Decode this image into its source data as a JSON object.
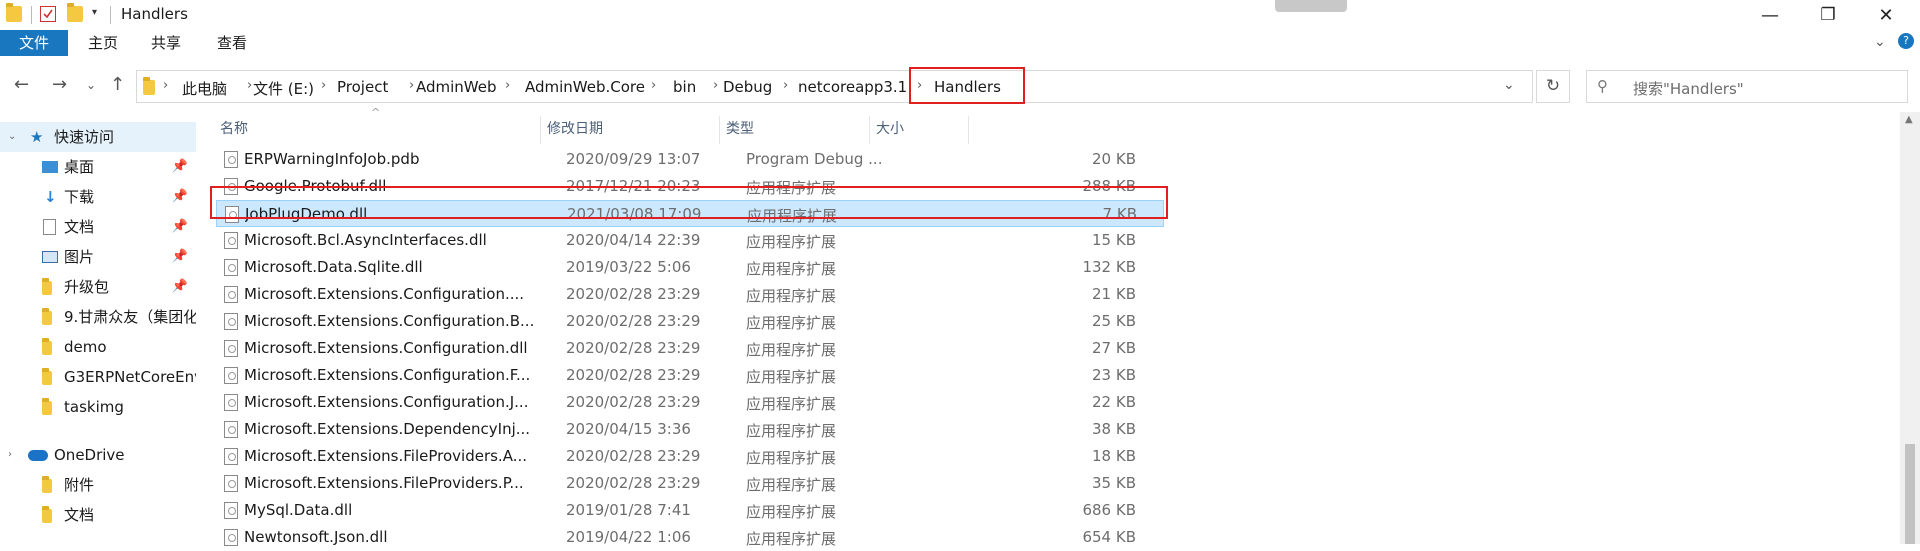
{
  "window": {
    "title": "Handlers",
    "minimize_glyph": "—",
    "restore_glyph": "❐",
    "close_glyph": "✕"
  },
  "ribbon": {
    "tabs": [
      "文件",
      "主页",
      "共享",
      "查看"
    ]
  },
  "address": {
    "crumbs": [
      "此电脑",
      "文件 (E:)",
      "Project",
      "AdminWeb",
      "AdminWeb.Core",
      "bin",
      "Debug",
      "netcoreapp3.1",
      "Handlers"
    ],
    "search_placeholder": "搜索\"Handlers\""
  },
  "columns": {
    "name": "名称",
    "date": "修改日期",
    "type": "类型",
    "size": "大小"
  },
  "nav": {
    "quick_access": "快速访问",
    "items": [
      {
        "label": "桌面",
        "pinned": true,
        "icon": "desktop-icon"
      },
      {
        "label": "下载",
        "pinned": true,
        "icon": "download-icon"
      },
      {
        "label": "文档",
        "pinned": true,
        "icon": "document-icon"
      },
      {
        "label": "图片",
        "pinned": true,
        "icon": "picture-icon"
      },
      {
        "label": "升级包",
        "pinned": true,
        "icon": "folder-icon"
      },
      {
        "label": "9.甘肃众友（集团化",
        "pinned": false,
        "icon": "folder-icon"
      },
      {
        "label": "demo",
        "pinned": false,
        "icon": "folder-icon"
      },
      {
        "label": "G3ERPNetCoreEnv",
        "pinned": false,
        "icon": "folder-icon"
      },
      {
        "label": "taskimg",
        "pinned": false,
        "icon": "folder-icon"
      }
    ],
    "onedrive": "OneDrive",
    "onedrive_items": [
      {
        "label": "附件",
        "icon": "folder-icon"
      },
      {
        "label": "文档",
        "icon": "folder-icon"
      }
    ]
  },
  "files": [
    {
      "name": "ERPWarningInfoJob.pdb",
      "date": "2020/09/29 13:07",
      "type": "Program Debug ...",
      "size": "20 KB",
      "selected": false
    },
    {
      "name": "Google.Protobuf.dll",
      "date": "2017/12/21 20:23",
      "type": "应用程序扩展",
      "size": "288 KB",
      "selected": false
    },
    {
      "name": "JobPlugDemo.dll",
      "date": "2021/03/08 17:09",
      "type": "应用程序扩展",
      "size": "7 KB",
      "selected": true
    },
    {
      "name": "Microsoft.Bcl.AsyncInterfaces.dll",
      "date": "2020/04/14 22:39",
      "type": "应用程序扩展",
      "size": "15 KB",
      "selected": false
    },
    {
      "name": "Microsoft.Data.Sqlite.dll",
      "date": "2019/03/22 5:06",
      "type": "应用程序扩展",
      "size": "132 KB",
      "selected": false
    },
    {
      "name": "Microsoft.Extensions.Configuration....",
      "date": "2020/02/28 23:29",
      "type": "应用程序扩展",
      "size": "21 KB",
      "selected": false
    },
    {
      "name": "Microsoft.Extensions.Configuration.B...",
      "date": "2020/02/28 23:29",
      "type": "应用程序扩展",
      "size": "25 KB",
      "selected": false
    },
    {
      "name": "Microsoft.Extensions.Configuration.dll",
      "date": "2020/02/28 23:29",
      "type": "应用程序扩展",
      "size": "27 KB",
      "selected": false
    },
    {
      "name": "Microsoft.Extensions.Configuration.F...",
      "date": "2020/02/28 23:29",
      "type": "应用程序扩展",
      "size": "23 KB",
      "selected": false
    },
    {
      "name": "Microsoft.Extensions.Configuration.J...",
      "date": "2020/02/28 23:29",
      "type": "应用程序扩展",
      "size": "22 KB",
      "selected": false
    },
    {
      "name": "Microsoft.Extensions.DependencyInj...",
      "date": "2020/04/15 3:36",
      "type": "应用程序扩展",
      "size": "38 KB",
      "selected": false
    },
    {
      "name": "Microsoft.Extensions.FileProviders.A...",
      "date": "2020/02/28 23:29",
      "type": "应用程序扩展",
      "size": "18 KB",
      "selected": false
    },
    {
      "name": "Microsoft.Extensions.FileProviders.P...",
      "date": "2020/02/28 23:29",
      "type": "应用程序扩展",
      "size": "35 KB",
      "selected": false
    },
    {
      "name": "MySql.Data.dll",
      "date": "2019/01/28 7:41",
      "type": "应用程序扩展",
      "size": "686 KB",
      "selected": false
    },
    {
      "name": "Newtonsoft.Json.dll",
      "date": "2019/04/22 1:06",
      "type": "应用程序扩展",
      "size": "654 KB",
      "selected": false
    }
  ],
  "colors": {
    "accent": "#1977c0",
    "highlight_red": "#e02020",
    "selection": "#cce8ff"
  }
}
